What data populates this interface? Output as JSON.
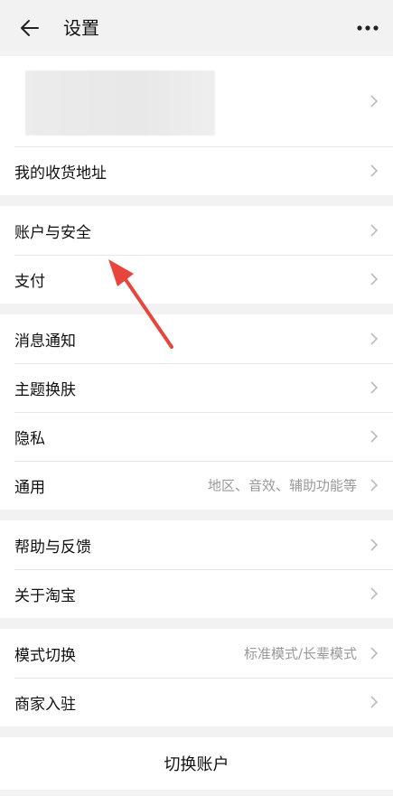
{
  "header": {
    "title": "设置"
  },
  "groups": {
    "g1": {
      "address": "我的收货地址"
    },
    "g2": {
      "account_security": "账户与安全",
      "payment": "支付"
    },
    "g3": {
      "notifications": "消息通知",
      "theme": "主题换肤",
      "privacy": "隐私",
      "general": "通用",
      "general_hint": "地区、音效、辅助功能等"
    },
    "g4": {
      "help": "帮助与反馈",
      "about": "关于淘宝"
    },
    "g5": {
      "mode": "模式切换",
      "mode_hint": "标准模式/长辈模式",
      "merchant": "商家入驻"
    }
  },
  "footer": {
    "switch_account": "切换账户"
  },
  "icons": {
    "back": "arrow-left-icon",
    "more": "more-dots-icon",
    "chevron": "chevron-right-icon"
  },
  "colors": {
    "annotation_arrow": "#e8453c"
  }
}
